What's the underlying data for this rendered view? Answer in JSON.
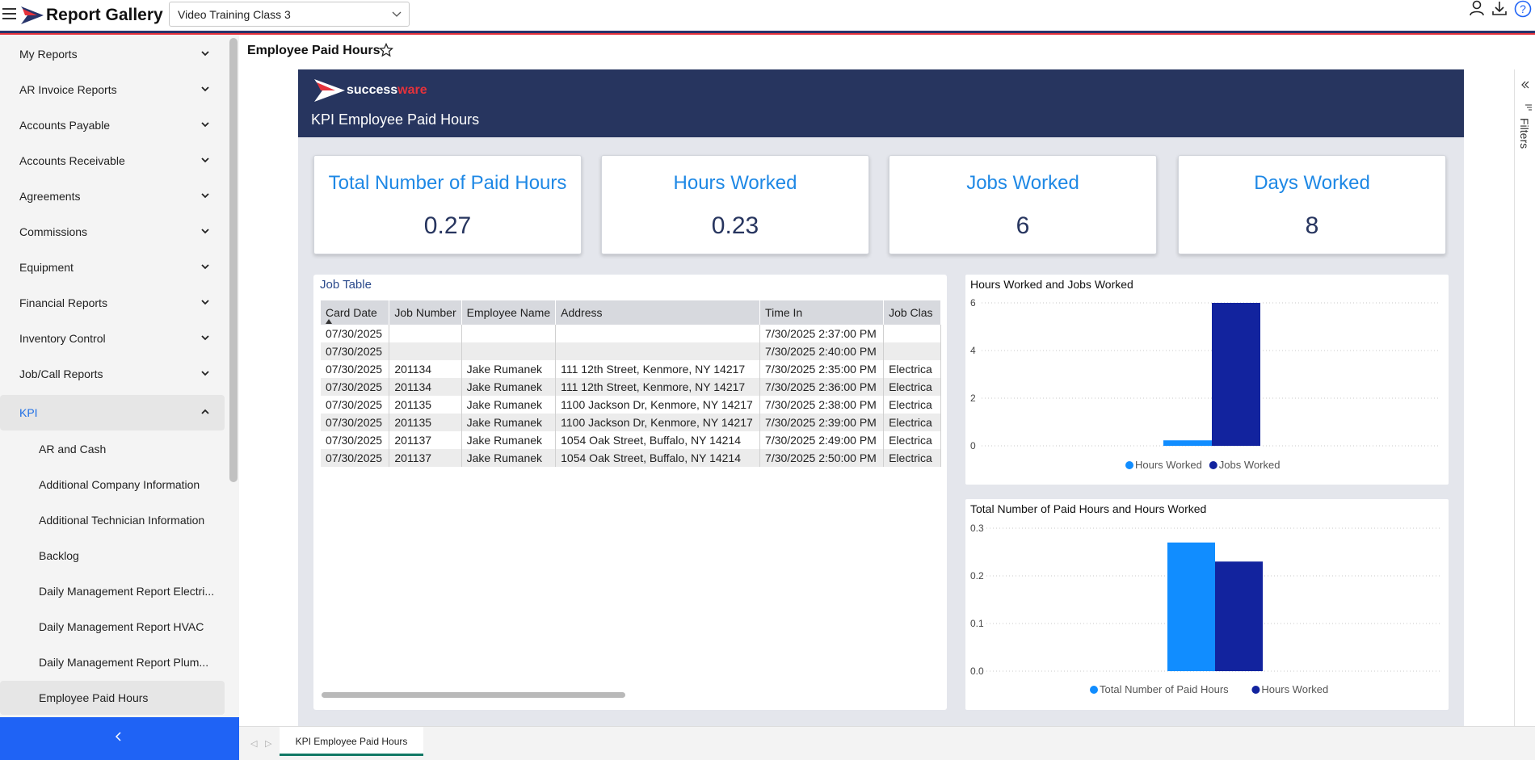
{
  "app": {
    "title": "Report Gallery",
    "workspace": "Video Training Class 3"
  },
  "sidebar": {
    "items": [
      {
        "label": "My Reports"
      },
      {
        "label": "AR Invoice Reports"
      },
      {
        "label": "Accounts Payable"
      },
      {
        "label": "Accounts Receivable"
      },
      {
        "label": "Agreements"
      },
      {
        "label": "Commissions"
      },
      {
        "label": "Equipment"
      },
      {
        "label": "Financial Reports"
      },
      {
        "label": "Inventory Control"
      },
      {
        "label": "Job/Call Reports"
      },
      {
        "label": "KPI"
      }
    ],
    "kpi_items": [
      {
        "label": "AR and Cash"
      },
      {
        "label": "Additional Company Information"
      },
      {
        "label": "Additional Technician Information"
      },
      {
        "label": "Backlog"
      },
      {
        "label": "Daily Management Report Electri..."
      },
      {
        "label": "Daily Management Report HVAC"
      },
      {
        "label": "Daily Management Report Plum..."
      },
      {
        "label": "Employee Paid Hours"
      }
    ]
  },
  "page": {
    "title": "Employee Paid Hours"
  },
  "report": {
    "brand_a": "success",
    "brand_b": "ware",
    "banner_title": "KPI Employee Paid Hours",
    "kpis": [
      {
        "title": "Total Number of Paid Hours",
        "value": "0.27"
      },
      {
        "title": "Hours Worked",
        "value": "0.23"
      },
      {
        "title": "Jobs Worked",
        "value": "6"
      },
      {
        "title": "Days Worked",
        "value": "8"
      }
    ],
    "table": {
      "caption": "Job Table",
      "columns": [
        "Card Date",
        "Job Number",
        "Employee Name",
        "Address",
        "Time In",
        "Job Clas"
      ],
      "rows": [
        [
          "07/30/2025",
          "",
          "",
          "",
          "7/30/2025 2:37:00 PM",
          ""
        ],
        [
          "07/30/2025",
          "",
          "",
          "",
          "7/30/2025 2:40:00 PM",
          ""
        ],
        [
          "07/30/2025",
          "201134",
          "Jake Rumanek",
          "111 12th Street, Kenmore, NY 14217",
          "7/30/2025 2:35:00 PM",
          "Electrica"
        ],
        [
          "07/30/2025",
          "201134",
          "Jake Rumanek",
          "111 12th Street, Kenmore, NY 14217",
          "7/30/2025 2:36:00 PM",
          "Electrica"
        ],
        [
          "07/30/2025",
          "201135",
          "Jake Rumanek",
          "1100 Jackson Dr, Kenmore, NY 14217",
          "7/30/2025 2:38:00 PM",
          "Electrica"
        ],
        [
          "07/30/2025",
          "201135",
          "Jake Rumanek",
          "1100 Jackson Dr, Kenmore, NY 14217",
          "7/30/2025 2:39:00 PM",
          "Electrica"
        ],
        [
          "07/30/2025",
          "201137",
          "Jake Rumanek",
          "1054 Oak Street, Buffalo, NY 14214",
          "7/30/2025 2:49:00 PM",
          "Electrica"
        ],
        [
          "07/30/2025",
          "201137",
          "Jake Rumanek",
          "1054 Oak Street, Buffalo, NY 14214",
          "7/30/2025 2:50:00 PM",
          "Electrica"
        ]
      ]
    },
    "filters_label": "Filters",
    "page_tab": "KPI Employee Paid Hours"
  },
  "colors": {
    "accent": "#1f63f5",
    "navy": "#27355f",
    "brand_red": "#e5323b",
    "series_light": "#118dff",
    "series_dark": "#12239e"
  },
  "chart_data": [
    {
      "type": "bar",
      "title": "Hours Worked and Jobs Worked",
      "categories": [
        ""
      ],
      "series": [
        {
          "name": "Hours Worked",
          "values": [
            0.23
          ]
        },
        {
          "name": "Jobs Worked",
          "values": [
            6
          ]
        }
      ],
      "ylim": [
        0,
        6
      ],
      "yticks": [
        "0",
        "2",
        "4",
        "6"
      ],
      "grid": true,
      "legend": "bottom"
    },
    {
      "type": "bar",
      "title": "Total Number of Paid Hours and Hours Worked",
      "categories": [
        ""
      ],
      "series": [
        {
          "name": "Total Number of Paid Hours",
          "values": [
            0.27
          ]
        },
        {
          "name": "Hours Worked",
          "values": [
            0.23
          ]
        }
      ],
      "ylim": [
        0,
        0.3
      ],
      "yticks": [
        "0.0",
        "0.1",
        "0.2",
        "0.3"
      ],
      "grid": true,
      "legend": "bottom"
    }
  ]
}
